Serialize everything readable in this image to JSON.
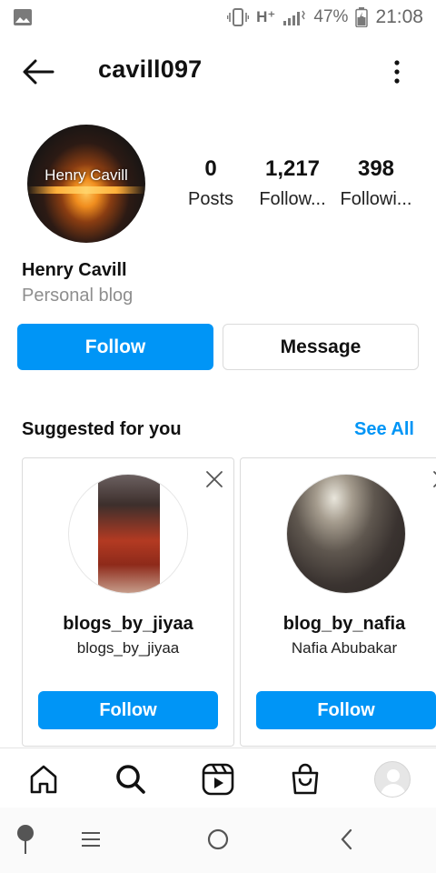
{
  "status_bar": {
    "network": "H⁺",
    "battery": "47%",
    "time": "21:08",
    "icons": [
      "gallery-icon",
      "vibrate-icon",
      "signal-icon",
      "battery-icon"
    ]
  },
  "header": {
    "username": "cavill097",
    "icons": [
      "back-arrow-icon",
      "more-options-icon"
    ]
  },
  "profile": {
    "avatar_text": "Henry Cavill",
    "display_name": "Henry Cavill",
    "bio": "Personal blog",
    "stats": {
      "posts": {
        "value": "0",
        "label": "Posts"
      },
      "followers": {
        "value": "1,217",
        "label": "Follow..."
      },
      "following": {
        "value": "398",
        "label": "Followi..."
      }
    },
    "follow_label": "Follow",
    "message_label": "Message"
  },
  "suggested": {
    "title": "Suggested for you",
    "see_all": "See All",
    "cards": [
      {
        "username": "blogs_by_jiyaa",
        "name": "blogs_by_jiyaa",
        "follow_label": "Follow"
      },
      {
        "username": "blog_by_nafia",
        "name": "Nafia Abubakar",
        "follow_label": "Follow"
      }
    ]
  },
  "bottom_nav": {
    "items": [
      "home-icon",
      "search-icon",
      "reels-icon",
      "shop-icon",
      "profile-avatar"
    ]
  },
  "system_nav": {
    "items": [
      "assistant-pin-icon",
      "recents-icon",
      "home-circle-icon",
      "back-chevron-icon"
    ]
  },
  "colors": {
    "accent": "#0095f6",
    "muted_text": "#8e8e8e",
    "border": "#dbdbdb"
  }
}
